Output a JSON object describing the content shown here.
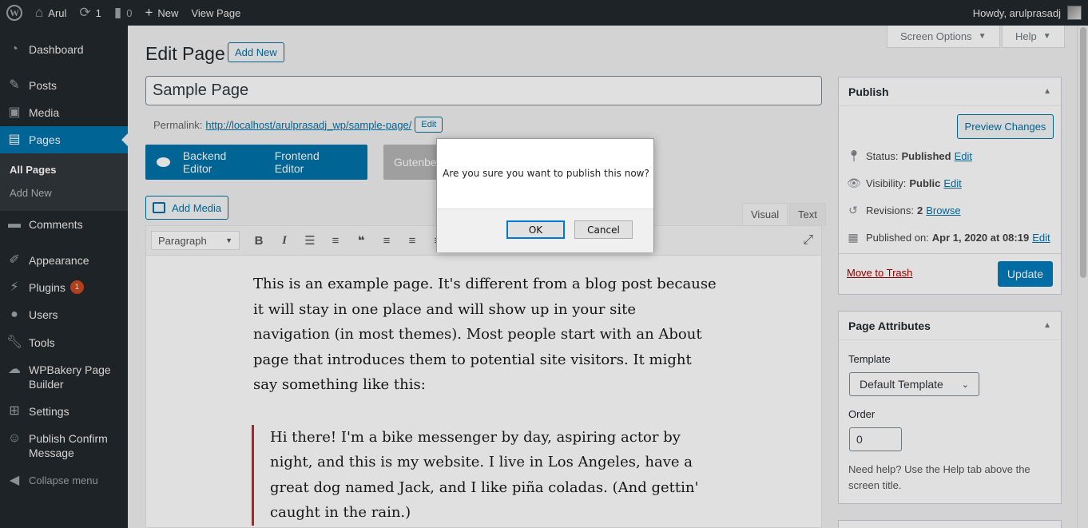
{
  "adminbar": {
    "site_name": "Arul",
    "updates_count": "1",
    "comments_count": "0",
    "new_label": "New",
    "view_page_label": "View Page",
    "howdy": "Howdy, arulprasadj"
  },
  "sidebar": {
    "items": [
      {
        "label": "Dashboard",
        "icon": "dashboard-icon"
      },
      {
        "label": "Posts",
        "icon": "pin-icon"
      },
      {
        "label": "Media",
        "icon": "media-icon"
      },
      {
        "label": "Pages",
        "icon": "pages-icon"
      },
      {
        "label": "Comments",
        "icon": "comments-icon"
      },
      {
        "label": "Appearance",
        "icon": "brush-icon"
      },
      {
        "label": "Plugins",
        "icon": "plugin-icon",
        "badge": "1"
      },
      {
        "label": "Users",
        "icon": "users-icon"
      },
      {
        "label": "Tools",
        "icon": "wrench-icon"
      },
      {
        "label": "WPBakery Page Builder",
        "icon": "cloud-icon"
      },
      {
        "label": "Settings",
        "icon": "settings-icon"
      },
      {
        "label": "Publish Confirm Message",
        "icon": "smile-icon"
      },
      {
        "label": "Collapse menu",
        "icon": "collapse-icon"
      }
    ],
    "submenu": [
      "All Pages",
      "Add New"
    ]
  },
  "header": {
    "screen_options": "Screen Options",
    "help": "Help",
    "title": "Edit Page",
    "add_new": "Add New"
  },
  "editor": {
    "post_title": "Sample Page",
    "permalink_label": "Permalink:",
    "permalink_url": "http://localhost/arulprasadj_wp/sample-page/",
    "permalink_edit": "Edit",
    "backend_editor": "Backend Editor",
    "frontend_editor": "Frontend Editor",
    "gutenberg": "Gutenberg Editor",
    "add_media": "Add Media",
    "tab_visual": "Visual",
    "tab_text": "Text",
    "format": "Paragraph",
    "paragraph": "This is an example page. It's different from a blog post because it will stay in one place and will show up in your site navigation (in most themes). Most people start with an About page that introduces them to potential site visitors. It might say something like this:",
    "quote": "Hi there! I'm a bike messenger by day, aspiring actor by night, and this is my website. I live in Los Angeles, have a great dog named Jack, and I like piña coladas. (And gettin' caught in the rain.)"
  },
  "publish": {
    "title": "Publish",
    "preview": "Preview Changes",
    "status_label": "Status:",
    "status_value": "Published",
    "visibility_label": "Visibility:",
    "visibility_value": "Public",
    "revisions_label": "Revisions:",
    "revisions_value": "2",
    "browse": "Browse",
    "published_label": "Published on:",
    "published_value": "Apr 1, 2020 at 08:19",
    "edit": "Edit",
    "trash": "Move to Trash",
    "update": "Update"
  },
  "attributes": {
    "title": "Page Attributes",
    "template_label": "Template",
    "template_value": "Default Template",
    "order_label": "Order",
    "order_value": "0",
    "help": "Need help? Use the Help tab above the screen title."
  },
  "dialog": {
    "message": "Are you sure you want to publish this now?",
    "ok": "OK",
    "cancel": "Cancel"
  },
  "colors": {
    "adminbar_bg": "#23282d",
    "accent": "#0073aa",
    "badge": "#ca4a1f"
  }
}
